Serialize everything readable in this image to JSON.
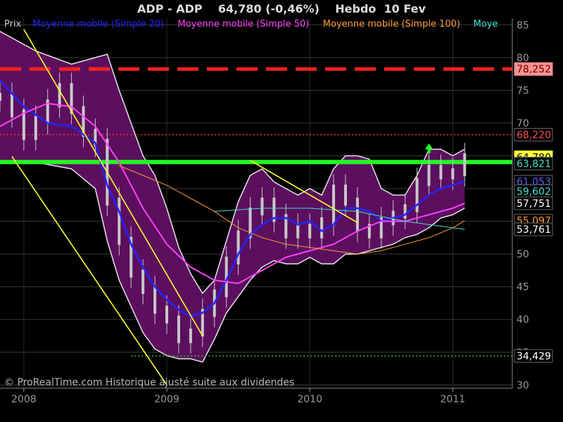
{
  "header": {
    "title": "ADP - ADP    64,780 (-0,46%)    Hebdo  10 Fev"
  },
  "legend": [
    {
      "label": "Prix",
      "color": "#c8c8c8"
    },
    {
      "label": "Moyenne mobile (Simple 20)",
      "color": "#2323ff"
    },
    {
      "label": "Moyenne mobile (Simple 50)",
      "color": "#ff40ff"
    },
    {
      "label": "Moyenne mobile (Simple 100)",
      "color": "#ff9a33"
    },
    {
      "label": "Moye",
      "color": "#40e0d0"
    }
  ],
  "watermark": "© ProRealTime.com Historique ajusté suite aux dividendes",
  "colors": {
    "background": "#000000",
    "bollinger_fill": "#5c0f5e",
    "candle": "#c8c8c8",
    "sma20": "#2323ff",
    "sma50": "#ff40ff",
    "sma100": "#ff9a33",
    "extra_ma": "#40e0d0",
    "resistance": "#ff2020",
    "support": "#22ff22",
    "trendline": "#ffff30"
  },
  "chart_data": {
    "type": "candlestick",
    "title": "ADP - ADP    64,780 (-0,46%)    Hebdo  10 Fev",
    "x_axis": {
      "range": [
        "2007-11",
        "2011-06"
      ],
      "ticks": [
        {
          "date": "2008-01",
          "label": "2008"
        },
        {
          "date": "2009-01",
          "label": "2009"
        },
        {
          "date": "2010-01",
          "label": "2010"
        },
        {
          "date": "2011-01",
          "label": "2011"
        }
      ]
    },
    "y_axis": {
      "position": "right",
      "range": [
        29.5,
        86
      ],
      "ticks": [
        30,
        35,
        40,
        45,
        50,
        55,
        60,
        65,
        70,
        75,
        80,
        85
      ],
      "grid": true
    },
    "price_labels": [
      {
        "value": 78.252,
        "label": "78,252",
        "bg": "#ff9090",
        "fg": "#600000"
      },
      {
        "value": 68.22,
        "label": "68,220",
        "bg": "#000000",
        "fg": "#ff5050"
      },
      {
        "value": 64.78,
        "label": "64,780",
        "bg": "#ffff40",
        "fg": "#000000"
      },
      {
        "value": 63.821,
        "label": "63,821",
        "bg": "#000000",
        "fg": "#40e0d0"
      },
      {
        "value": 61.053,
        "label": "61,053",
        "bg": "#000000",
        "fg": "#6060ff"
      },
      {
        "value": 59.602,
        "label": "59,602",
        "bg": "#000000",
        "fg": "#40e0d0"
      },
      {
        "value": 57.751,
        "label": "57,751",
        "bg": "#000000",
        "fg": "#ffffff"
      },
      {
        "value": 55.097,
        "label": "55,097",
        "bg": "#000000",
        "fg": "#ff9a33"
      },
      {
        "value": 53.761,
        "label": "53,761",
        "bg": "#000000",
        "fg": "#ffffff"
      },
      {
        "value": 34.429,
        "label": "34,429",
        "bg": "#000000",
        "fg": "#ffffff"
      }
    ],
    "horizontal_lines": [
      {
        "name": "resistance-dashed",
        "value": 78.252,
        "color": "#ff2020",
        "style": "dashed-thick"
      },
      {
        "name": "level-dotted",
        "value": 68.22,
        "color": "#ff3030",
        "style": "dotted"
      },
      {
        "name": "support",
        "value": 64.05,
        "color": "#22ff22",
        "style": "solid-thick"
      },
      {
        "name": "low-dotted",
        "value": 34.429,
        "color": "#30c030",
        "style": "dotted",
        "from": "2008-10"
      }
    ],
    "trendlines": [
      {
        "from": [
          "2008-01",
          84.3
        ],
        "to": [
          "2009-04",
          37.5
        ]
      },
      {
        "from": [
          "2007-12",
          64.9
        ],
        "to": [
          "2009-01",
          30.0
        ]
      },
      {
        "from": [
          "2009-08",
          64.3
        ],
        "to": [
          "2010-05",
          54.8
        ]
      }
    ],
    "arrow": {
      "date": "2010-11",
      "value": 66.0,
      "color": "#22ff22"
    },
    "series": [
      {
        "name": "Moyenne mobile (Simple 20)",
        "type": "line",
        "color": "#2323ff",
        "points": [
          [
            "2007-11",
            76.5
          ],
          [
            "2008-01",
            72.5
          ],
          [
            "2008-03",
            70.0
          ],
          [
            "2008-05",
            69.5
          ],
          [
            "2008-07",
            67.0
          ],
          [
            "2008-08",
            60.5
          ],
          [
            "2008-09",
            56.5
          ],
          [
            "2008-10",
            51.5
          ],
          [
            "2008-11",
            48.0
          ],
          [
            "2008-12",
            45.0
          ],
          [
            "2009-01",
            43.0
          ],
          [
            "2009-02",
            41.5
          ],
          [
            "2009-03",
            40.5
          ],
          [
            "2009-04",
            41.0
          ],
          [
            "2009-05",
            42.5
          ],
          [
            "2009-06",
            46.0
          ],
          [
            "2009-07",
            50.0
          ],
          [
            "2009-08",
            53.0
          ],
          [
            "2009-09",
            54.5
          ],
          [
            "2009-10",
            55.5
          ],
          [
            "2009-11",
            55.5
          ],
          [
            "2009-12",
            54.5
          ],
          [
            "2010-01",
            55.0
          ],
          [
            "2010-02",
            53.5
          ],
          [
            "2010-03",
            54.5
          ],
          [
            "2010-04",
            57.0
          ],
          [
            "2010-05",
            57.0
          ],
          [
            "2010-06",
            56.5
          ],
          [
            "2010-07",
            55.0
          ],
          [
            "2010-08",
            55.5
          ],
          [
            "2010-09",
            56.0
          ],
          [
            "2010-10",
            57.5
          ],
          [
            "2010-11",
            59.0
          ],
          [
            "2010-12",
            60.0
          ],
          [
            "2011-01",
            60.5
          ],
          [
            "2011-02",
            61.05
          ]
        ]
      },
      {
        "name": "Moyenne mobile (Simple 50)",
        "type": "line",
        "color": "#ff40ff",
        "points": [
          [
            "2007-11",
            69.5
          ],
          [
            "2008-01",
            71.5
          ],
          [
            "2008-03",
            73.0
          ],
          [
            "2008-05",
            72.5
          ],
          [
            "2008-07",
            69.5
          ],
          [
            "2008-09",
            64.0
          ],
          [
            "2008-11",
            57.0
          ],
          [
            "2009-01",
            51.5
          ],
          [
            "2009-03",
            48.0
          ],
          [
            "2009-05",
            46.0
          ],
          [
            "2009-07",
            45.5
          ],
          [
            "2009-09",
            47.5
          ],
          [
            "2009-11",
            49.5
          ],
          [
            "2010-01",
            50.5
          ],
          [
            "2010-03",
            51.5
          ],
          [
            "2010-05",
            53.5
          ],
          [
            "2010-07",
            55.0
          ],
          [
            "2010-09",
            55.0
          ],
          [
            "2010-11",
            56.0
          ],
          [
            "2011-01",
            57.0
          ],
          [
            "2011-02",
            57.75
          ]
        ]
      },
      {
        "name": "Moyenne mobile (Simple 100)",
        "type": "line",
        "color": "#ff9a33",
        "points": [
          [
            "2008-09",
            63.5
          ],
          [
            "2008-11",
            62.0
          ],
          [
            "2009-01",
            60.5
          ],
          [
            "2009-03",
            58.5
          ],
          [
            "2009-05",
            56.5
          ],
          [
            "2009-07",
            54.0
          ],
          [
            "2009-09",
            52.5
          ],
          [
            "2009-11",
            51.5
          ],
          [
            "2010-01",
            51.0
          ],
          [
            "2010-03",
            50.5
          ],
          [
            "2010-05",
            50.0
          ],
          [
            "2010-07",
            50.5
          ],
          [
            "2010-09",
            51.5
          ],
          [
            "2010-11",
            52.5
          ],
          [
            "2011-01",
            54.0
          ],
          [
            "2011-02",
            55.1
          ]
        ]
      },
      {
        "name": "Moye",
        "type": "line",
        "color": "#40e0d0",
        "points": [
          [
            "2009-05",
            56.5
          ],
          [
            "2009-09",
            57.0
          ],
          [
            "2010-01",
            57.0
          ],
          [
            "2010-05",
            56.5
          ],
          [
            "2010-09",
            55.0
          ],
          [
            "2011-01",
            54.0
          ],
          [
            "2011-02",
            53.76
          ]
        ]
      },
      {
        "name": "bollinger",
        "type": "band",
        "color": "#5c0f5e",
        "upper": [
          [
            "2007-11",
            84.0
          ],
          [
            "2008-02",
            81.0
          ],
          [
            "2008-05",
            79.0
          ],
          [
            "2008-08",
            80.5
          ],
          [
            "2008-09",
            75.0
          ],
          [
            "2008-10",
            70.0
          ],
          [
            "2008-11",
            65.0
          ],
          [
            "2008-12",
            62.0
          ],
          [
            "2009-01",
            57.0
          ],
          [
            "2009-02",
            51.0
          ],
          [
            "2009-03",
            47.0
          ],
          [
            "2009-04",
            44.0
          ],
          [
            "2009-05",
            46.0
          ],
          [
            "2009-06",
            52.0
          ],
          [
            "2009-07",
            58.0
          ],
          [
            "2009-08",
            62.0
          ],
          [
            "2009-09",
            63.0
          ],
          [
            "2009-10",
            61.0
          ],
          [
            "2009-11",
            60.0
          ],
          [
            "2009-12",
            59.0
          ],
          [
            "2010-01",
            60.0
          ],
          [
            "2010-02",
            59.0
          ],
          [
            "2010-03",
            63.0
          ],
          [
            "2010-04",
            65.0
          ],
          [
            "2010-05",
            65.0
          ],
          [
            "2010-06",
            64.5
          ],
          [
            "2010-07",
            60.0
          ],
          [
            "2010-08",
            59.0
          ],
          [
            "2010-09",
            59.0
          ],
          [
            "2010-10",
            62.0
          ],
          [
            "2010-11",
            66.0
          ],
          [
            "2010-12",
            66.0
          ],
          [
            "2011-01",
            65.0
          ],
          [
            "2011-02",
            66.0
          ]
        ],
        "lower": [
          [
            "2007-11",
            64.0
          ],
          [
            "2008-02",
            64.0
          ],
          [
            "2008-05",
            63.0
          ],
          [
            "2008-07",
            60.0
          ],
          [
            "2008-08",
            52.0
          ],
          [
            "2008-09",
            46.0
          ],
          [
            "2008-10",
            42.0
          ],
          [
            "2008-11",
            38.0
          ],
          [
            "2008-12",
            35.5
          ],
          [
            "2009-01",
            34.5
          ],
          [
            "2009-02",
            34.0
          ],
          [
            "2009-03",
            34.0
          ],
          [
            "2009-04",
            33.5
          ],
          [
            "2009-05",
            37.0
          ],
          [
            "2009-06",
            41.0
          ],
          [
            "2009-07",
            43.5
          ],
          [
            "2009-08",
            46.0
          ],
          [
            "2009-09",
            48.0
          ],
          [
            "2009-10",
            49.0
          ],
          [
            "2009-11",
            48.5
          ],
          [
            "2009-12",
            48.5
          ],
          [
            "2010-01",
            49.5
          ],
          [
            "2010-02",
            48.5
          ],
          [
            "2010-03",
            48.5
          ],
          [
            "2010-04",
            50.0
          ],
          [
            "2010-05",
            50.0
          ],
          [
            "2010-06",
            50.5
          ],
          [
            "2010-07",
            51.0
          ],
          [
            "2010-08",
            51.5
          ],
          [
            "2010-09",
            52.5
          ],
          [
            "2010-10",
            53.0
          ],
          [
            "2010-11",
            54.0
          ],
          [
            "2010-12",
            55.5
          ],
          [
            "2011-01",
            56.0
          ],
          [
            "2011-02",
            57.0
          ]
        ]
      },
      {
        "name": "Prix",
        "type": "candles",
        "color": "#c8c8c8",
        "points": [
          [
            "2007-11",
            74.0
          ],
          [
            "2007-12",
            71.5
          ],
          [
            "2008-01",
            68.0
          ],
          [
            "2008-02",
            70.5
          ],
          [
            "2008-03",
            73.0
          ],
          [
            "2008-04",
            75.5
          ],
          [
            "2008-05",
            72.0
          ],
          [
            "2008-06",
            68.5
          ],
          [
            "2008-07",
            67.0
          ],
          [
            "2008-08",
            58.0
          ],
          [
            "2008-09",
            52.0
          ],
          [
            "2008-10",
            47.0
          ],
          [
            "2008-11",
            44.5
          ],
          [
            "2008-12",
            41.5
          ],
          [
            "2009-01",
            40.0
          ],
          [
            "2009-02",
            37.0
          ],
          [
            "2009-03",
            38.0
          ],
          [
            "2009-04",
            41.0
          ],
          [
            "2009-05",
            44.0
          ],
          [
            "2009-06",
            49.0
          ],
          [
            "2009-07",
            53.0
          ],
          [
            "2009-08",
            56.5
          ],
          [
            "2009-09",
            58.0
          ],
          [
            "2009-10",
            55.5
          ],
          [
            "2009-11",
            53.0
          ],
          [
            "2009-12",
            54.0
          ],
          [
            "2010-01",
            53.0
          ],
          [
            "2010-02",
            55.0
          ],
          [
            "2010-03",
            60.0
          ],
          [
            "2010-04",
            58.0
          ],
          [
            "2010-05",
            54.0
          ],
          [
            "2010-06",
            53.0
          ],
          [
            "2010-07",
            55.0
          ],
          [
            "2010-08",
            56.0
          ],
          [
            "2010-09",
            57.0
          ],
          [
            "2010-10",
            61.0
          ],
          [
            "2010-11",
            63.0
          ],
          [
            "2010-12",
            62.0
          ],
          [
            "2011-01",
            62.5
          ],
          [
            "2011-02",
            64.78
          ]
        ]
      }
    ]
  }
}
